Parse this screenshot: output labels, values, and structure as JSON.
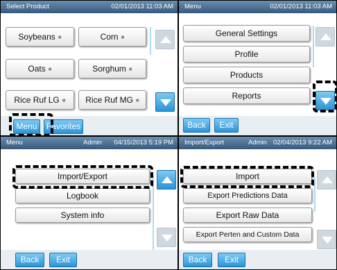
{
  "panel1": {
    "title": "Select Product",
    "timestamp": "02/01/2013 11:03 AM",
    "products": [
      "Soybeans",
      "Corn",
      "Oats",
      "Sorghum",
      "Rice Ruf LG",
      "Rice Ruf MG"
    ],
    "menu_label": "Menu",
    "favorites_label": "Favorites"
  },
  "panel2": {
    "title": "Menu",
    "timestamp": "02/01/2013 11:03 AM",
    "items": [
      "General Settings",
      "Profile",
      "Products",
      "Reports"
    ],
    "back_label": "Back",
    "exit_label": "Exit"
  },
  "panel3": {
    "title": "Menu",
    "user": "Admin",
    "timestamp": "04/15/2013 5:19 PM",
    "items": [
      "Import/Export",
      "Logbook",
      "System info"
    ],
    "back_label": "Back",
    "exit_label": "Exit"
  },
  "panel4": {
    "title": "Import/Export",
    "user": "Admin",
    "timestamp": "02/04/2013 9:22 AM",
    "items": [
      "Import",
      "Export Predictions Data",
      "Export Raw Data",
      "Export Perten and Custom Data"
    ],
    "back_label": "Back",
    "exit_label": "Exit"
  },
  "icons": {
    "lock": "lock-icon",
    "scroll_up": "arrow-up-icon",
    "scroll_down": "arrow-down-icon"
  },
  "colors": {
    "header": "#36587c",
    "button_blue": "#2a95d8",
    "arrow_disabled": "#cfd8df",
    "highlight": "#000000"
  }
}
